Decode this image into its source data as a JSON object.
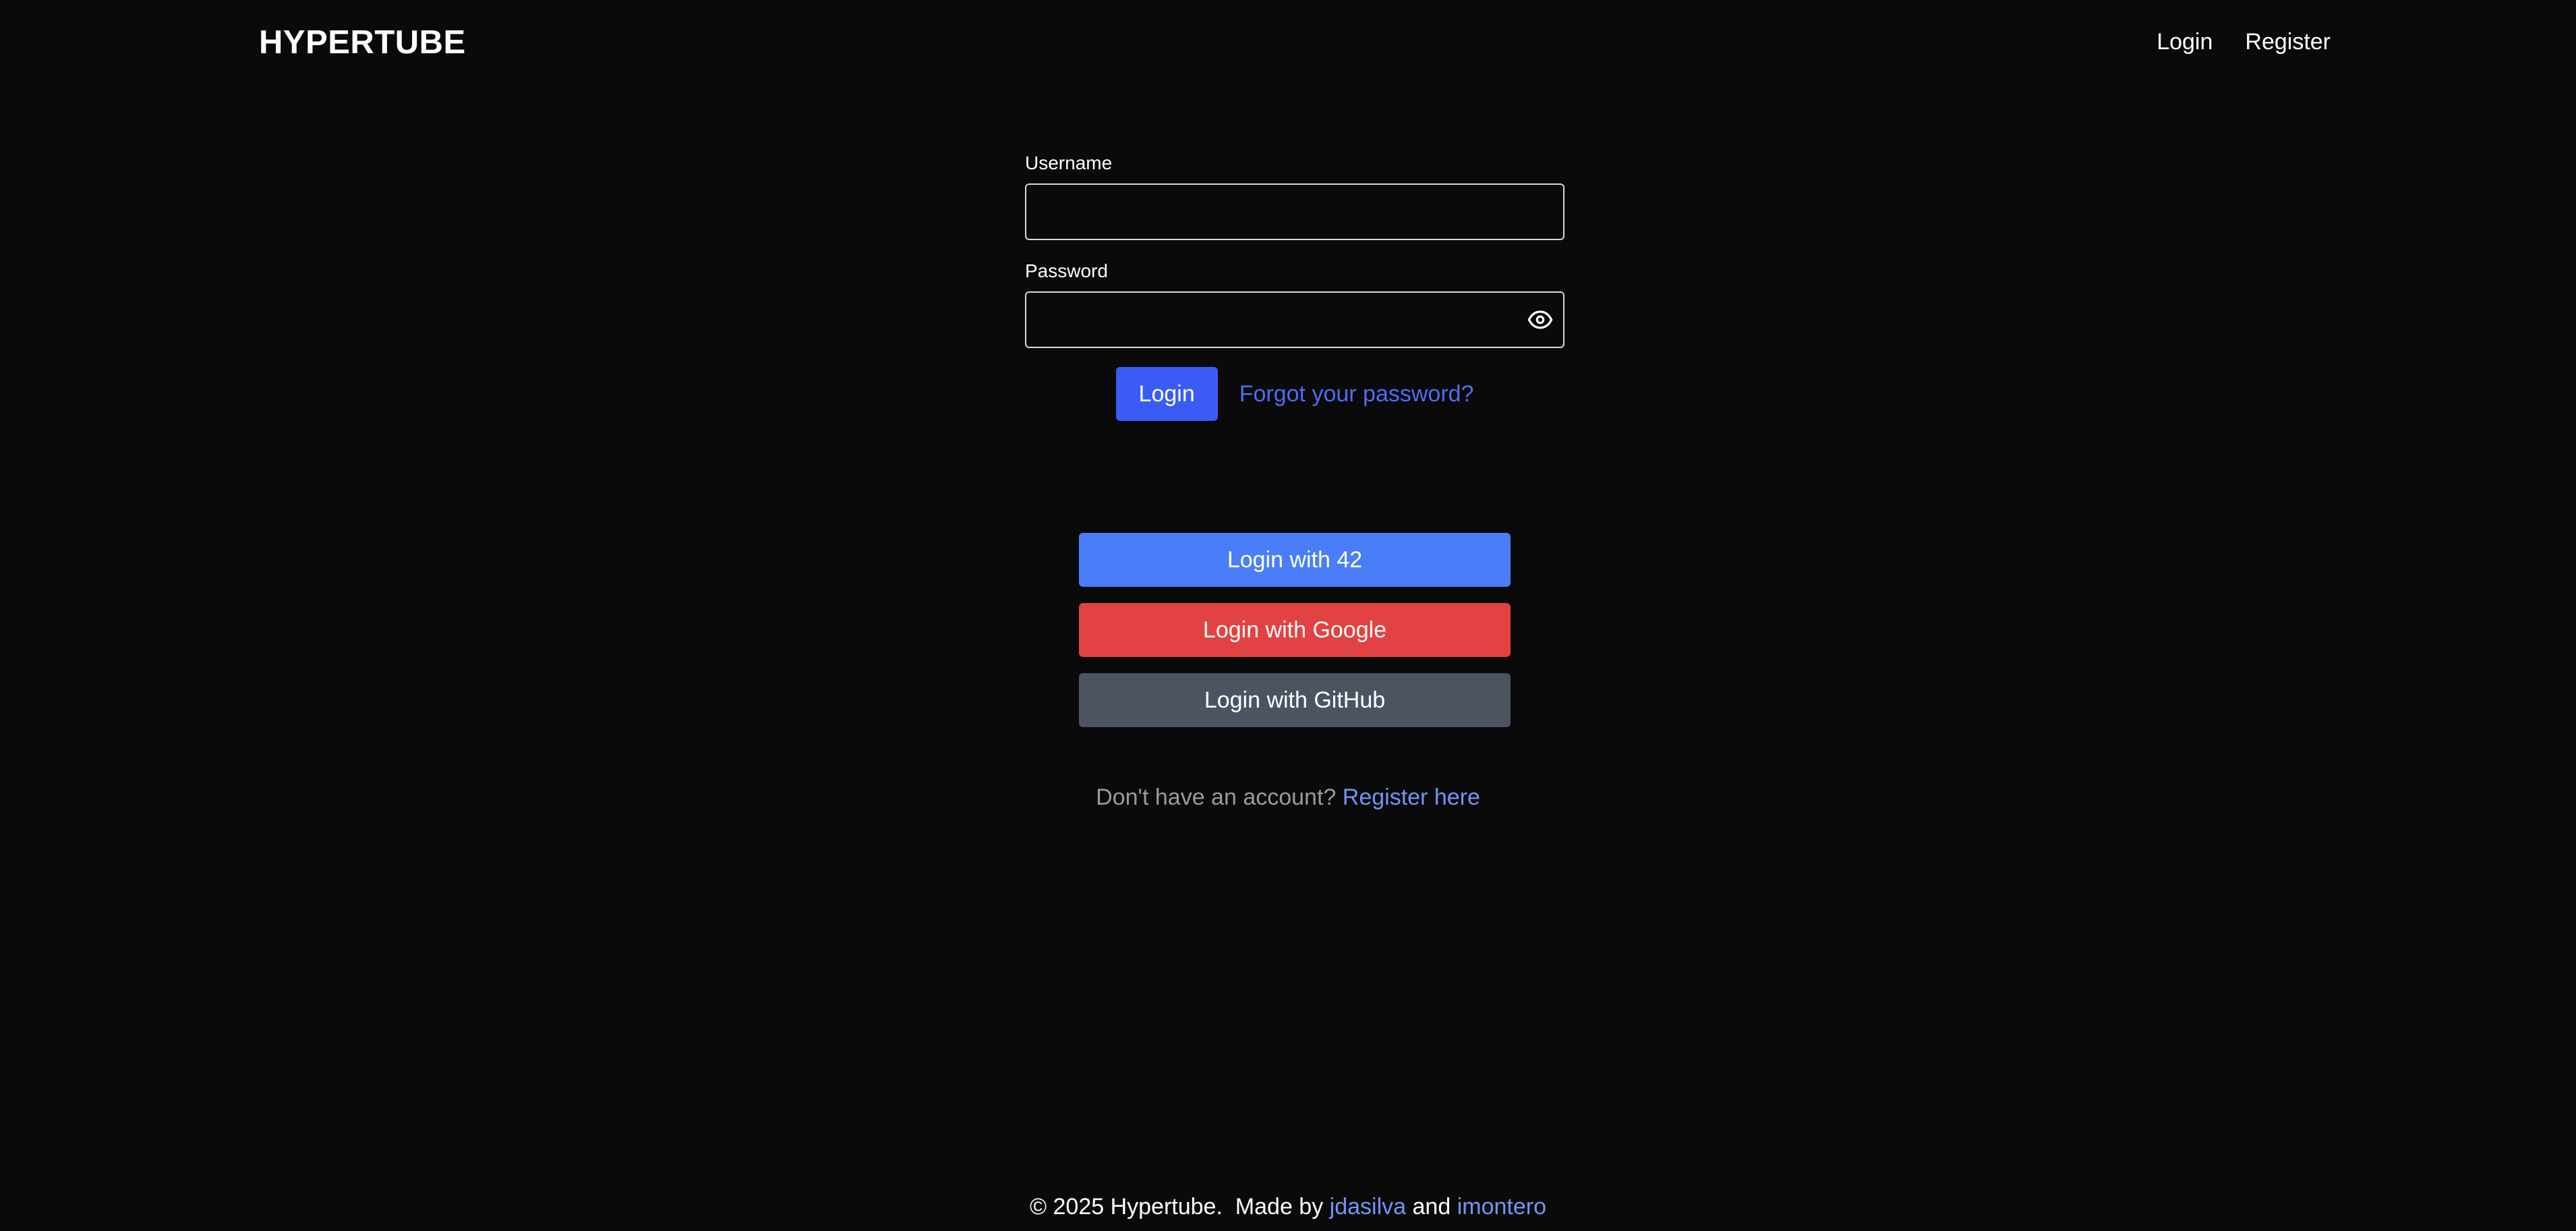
{
  "header": {
    "brand": "HYPERTUBE",
    "nav": {
      "login": "Login",
      "register": "Register"
    }
  },
  "form": {
    "username_label": "Username",
    "username_value": "",
    "password_label": "Password",
    "password_value": "",
    "password_toggle_icon": "eye-icon",
    "login_button": "Login",
    "forgot_link": "Forgot your password?"
  },
  "oauth": {
    "buttons": [
      {
        "label": "Login with 42",
        "color": "#4a7ef8"
      },
      {
        "label": "Login with Google",
        "color": "#e34242"
      },
      {
        "label": "Login with GitHub",
        "color": "#4d5461"
      }
    ]
  },
  "register_prompt": {
    "text": "Don't have an account?",
    "link": "Register here"
  },
  "footer": {
    "copyright": "© 2025 Hypertube.  Made by",
    "author1": "jdasilva",
    "and": "and",
    "author2": "imontero"
  },
  "colors": {
    "background": "#0a0a0a",
    "accent": "#3b5bf5",
    "link": "#6f96f7"
  }
}
